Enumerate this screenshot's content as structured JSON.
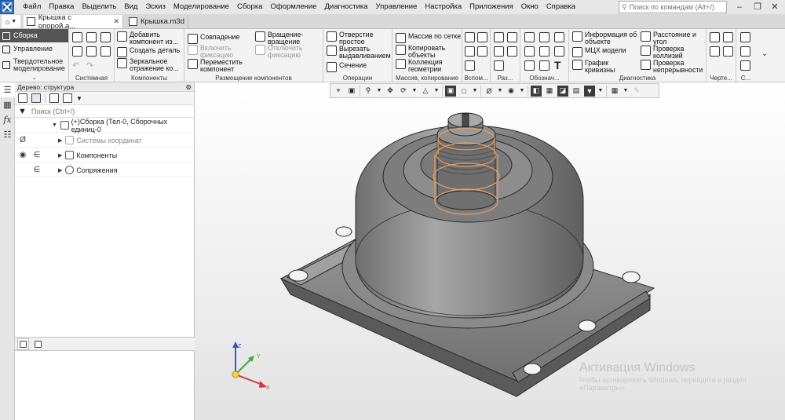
{
  "app": {
    "menu": [
      "Файл",
      "Правка",
      "Выделить",
      "Вид",
      "Эскиз",
      "Моделирование",
      "Сборка",
      "Оформление",
      "Диагностика",
      "Управление",
      "Настройка",
      "Приложения",
      "Окно",
      "Справка"
    ],
    "command_search_placeholder": "Поиск по командам (Alt+/)"
  },
  "tabs": [
    {
      "label": "Крышка с опорой.а...",
      "active": true
    },
    {
      "label": "Крышка.m3d",
      "active": false
    }
  ],
  "modes": [
    "Сборка",
    "Управление",
    "Твердотельное моделирование"
  ],
  "ribbon": {
    "system": {
      "caption": "Системная"
    },
    "components": {
      "caption": "Компоненты",
      "add_component": "Добавить компонент из...",
      "create_part": "Создать деталь",
      "mirror_component": "Зеркальное отражение ко..."
    },
    "placement": {
      "caption": "Размещение компонентов",
      "coincidence": "Совпадение",
      "enable_fix": "Включить фиксацию",
      "move_component": "Переместить компонент",
      "rotation": "Вращение-вращение",
      "disable_fix": "Отключить фиксацию"
    },
    "operations": {
      "caption": "Операции",
      "hole_simple": "Отверстие простое",
      "cut_extrude": "Вырезать выдавливанием",
      "section": "Сечение"
    },
    "arrays": {
      "caption": "Массив, копирование",
      "grid_array": "Массив по сетке",
      "copy_objects": "Копировать объекты",
      "geometry_collection": "Коллекция геометрии"
    },
    "aux": {
      "caption": "Вспом..."
    },
    "sizes": {
      "caption": "Раз..."
    },
    "notation": {
      "caption": "Обознач..."
    },
    "diagnostics": {
      "caption": "Диагностика",
      "object_info": "Информация об объекте",
      "mass_properties": "МЦХ модели",
      "curvature_graph": "График кривизны",
      "distance_angle": "Расстояние и угол",
      "collision_check": "Проверка коллизий",
      "continuity_check": "Проверка непрерывности"
    },
    "drawing": {
      "caption": "Черте..."
    },
    "c": {
      "caption": "С..."
    }
  },
  "tree": {
    "title": "Дерево: структура",
    "search_placeholder": "Поиск (Ctrl+/)",
    "root": "(+)Сборка (Тел-0, Сборочных единиц-0",
    "items": [
      {
        "label": "Системы координат",
        "dim": true
      },
      {
        "label": "Компоненты",
        "dim": false
      },
      {
        "label": "Сопряжения",
        "dim": false
      }
    ]
  },
  "axes": {
    "x": "X",
    "y": "Y",
    "z": "Z"
  },
  "watermark": {
    "line1": "Активация Windows",
    "line2": "Чтобы активировать Windows, перейдите в раздел «Параметры»."
  },
  "colors": {
    "accent_dark": "#545454",
    "selection_orange": "#e8a060",
    "model_gray": "#8c8c8c"
  }
}
